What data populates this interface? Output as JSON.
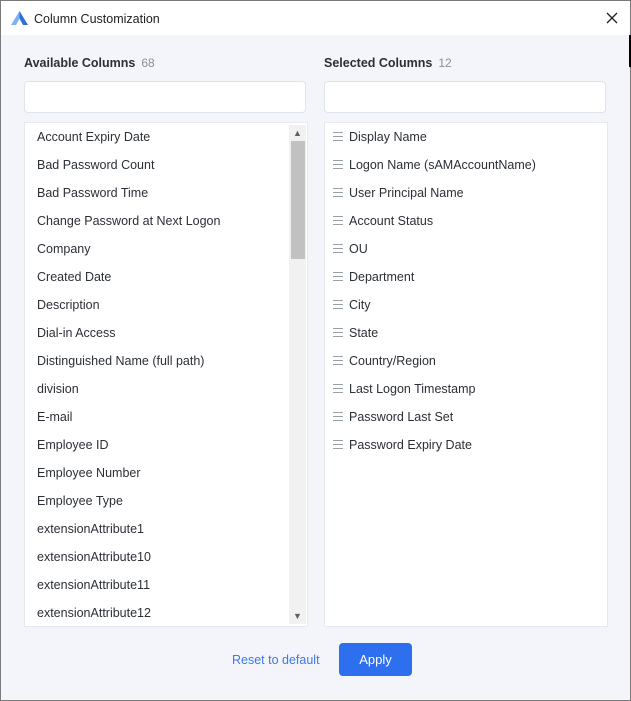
{
  "window": {
    "title": "Column Customization",
    "icon": "app-logo-icon",
    "close_icon": "close-icon"
  },
  "available": {
    "header": "Available Columns",
    "count": "68",
    "search": {
      "value": "",
      "placeholder": ""
    },
    "items": [
      "Account Expiry Date",
      "Bad Password Count",
      "Bad Password Time",
      "Change Password at Next Logon",
      "Company",
      "Created Date",
      "Description",
      "Dial-in Access",
      "Distinguished Name (full path)",
      "division",
      "E-mail",
      "Employee ID",
      "Employee Number",
      "Employee Type",
      "extensionAttribute1",
      "extensionAttribute10",
      "extensionAttribute11",
      "extensionAttribute12"
    ]
  },
  "selected": {
    "header": "Selected Columns",
    "count": "12",
    "search": {
      "value": "",
      "placeholder": ""
    },
    "items": [
      "Display Name",
      "Logon Name (sAMAccountName)",
      "User Principal Name",
      "Account Status",
      "OU",
      "Department",
      "City",
      "State",
      "Country/Region",
      "Last Logon Timestamp",
      "Password Last Set",
      "Password Expiry Date"
    ]
  },
  "footer": {
    "reset_label": "Reset to default",
    "apply_label": "Apply"
  },
  "colors": {
    "accent": "#2e6ff0",
    "link": "#3d7ae6",
    "background": "#f3f5fa"
  }
}
